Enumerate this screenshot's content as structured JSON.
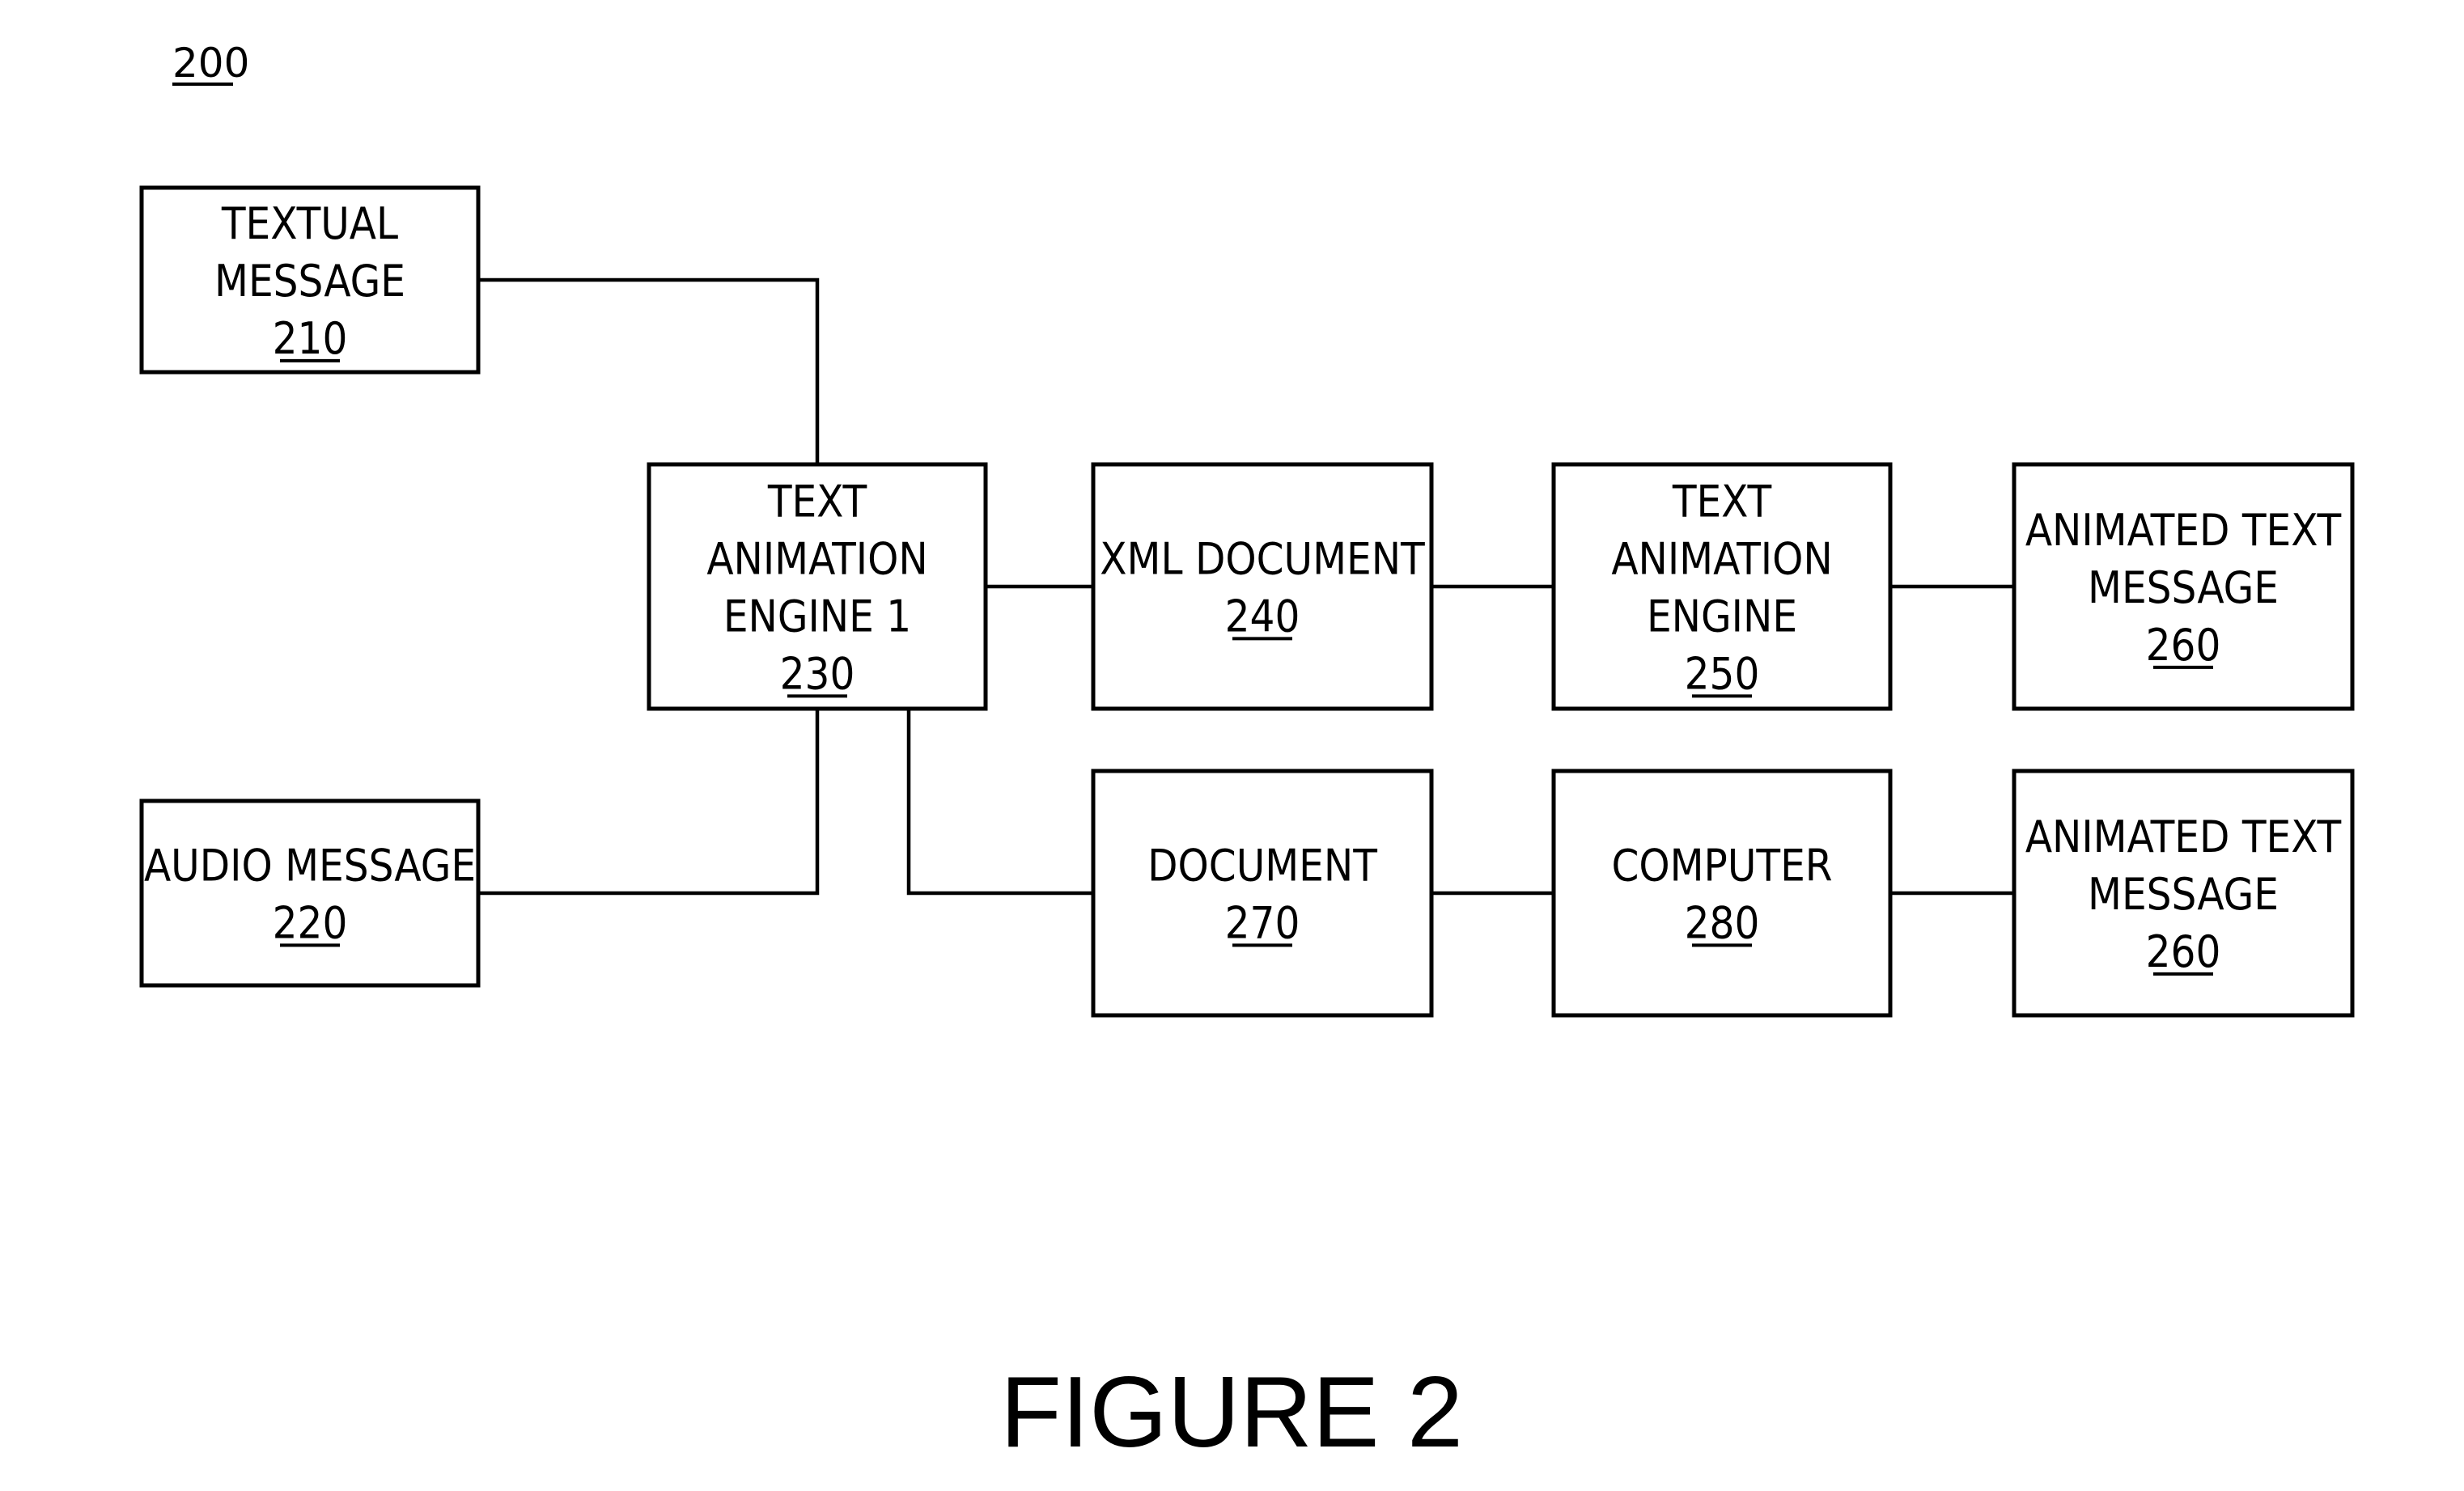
{
  "figure": {
    "reference": "200",
    "caption": "FIGURE 2",
    "line_color": "#000000",
    "background": "#ffffff"
  },
  "nodes": [
    {
      "id": "210",
      "lines": [
        "TEXTUAL",
        "MESSAGE"
      ],
      "ref": "210"
    },
    {
      "id": "220",
      "lines": [
        "AUDIO MESSAGE"
      ],
      "ref": "220"
    },
    {
      "id": "230",
      "lines": [
        "TEXT",
        "ANIMATION",
        "ENGINE 1"
      ],
      "ref": "230"
    },
    {
      "id": "240",
      "lines": [
        "XML DOCUMENT"
      ],
      "ref": "240"
    },
    {
      "id": "250",
      "lines": [
        "TEXT",
        "ANIMATION",
        "ENGINE"
      ],
      "ref": "250"
    },
    {
      "id": "260a",
      "lines": [
        "ANIMATED TEXT",
        "MESSAGE"
      ],
      "ref": "260"
    },
    {
      "id": "270",
      "lines": [
        "DOCUMENT"
      ],
      "ref": "270"
    },
    {
      "id": "280",
      "lines": [
        "COMPUTER"
      ],
      "ref": "280"
    },
    {
      "id": "260b",
      "lines": [
        "ANIMATED TEXT",
        "MESSAGE"
      ],
      "ref": "260"
    }
  ],
  "edges": [
    {
      "from": "210",
      "to": "230"
    },
    {
      "from": "220",
      "to": "230"
    },
    {
      "from": "230",
      "to": "240"
    },
    {
      "from": "240",
      "to": "250"
    },
    {
      "from": "250",
      "to": "260a"
    },
    {
      "from": "230",
      "to": "270"
    },
    {
      "from": "270",
      "to": "280"
    },
    {
      "from": "280",
      "to": "260b"
    }
  ]
}
